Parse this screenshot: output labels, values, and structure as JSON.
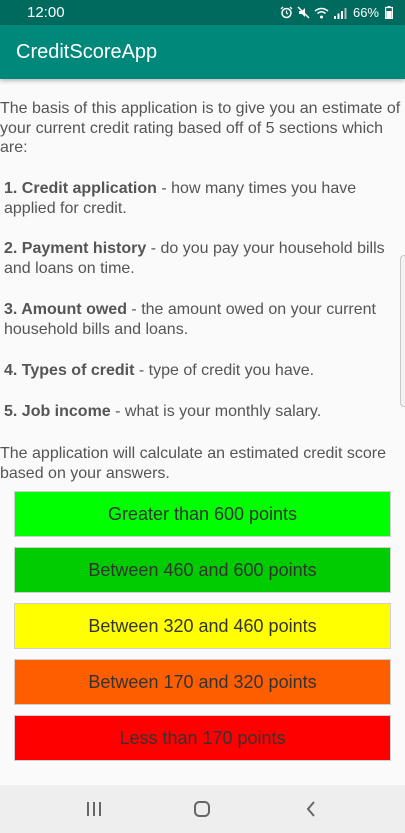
{
  "status_bar": {
    "time": "12:00",
    "battery": "66%"
  },
  "app_bar": {
    "title": "CreditScoreApp"
  },
  "intro": "The basis of this application is to give you an estimate of your current credit rating based off of 5 sections which are:",
  "sections": [
    {
      "title": "1. Credit application",
      "desc": " - how many times you have applied for credit."
    },
    {
      "title": "2. Payment history",
      "desc": " - do you pay your household bills and loans on time."
    },
    {
      "title": "3. Amount owed",
      "desc": " - the amount owed on your current household bills and loans."
    },
    {
      "title": "4. Types of credit",
      "desc": " - type of credit you have."
    },
    {
      "title": "5. Job income",
      "desc": " - what is your monthly salary."
    }
  ],
  "outro": "The application will calculate an estimated credit score based on your answers.",
  "score_buttons": [
    {
      "label": "Greater than 600 points",
      "color": "#00ff00"
    },
    {
      "label": "Between 460 and 600 points",
      "color": "#00cc00"
    },
    {
      "label": "Between 320 and 460 points",
      "color": "#ffff00"
    },
    {
      "label": "Between 170 and 320 points",
      "color": "#ff5e00"
    },
    {
      "label": "Less than 170 points",
      "color": "#ff0000"
    }
  ],
  "nav_bar": {
    "recents": "recents-icon",
    "home": "home-icon",
    "back": "back-icon"
  }
}
